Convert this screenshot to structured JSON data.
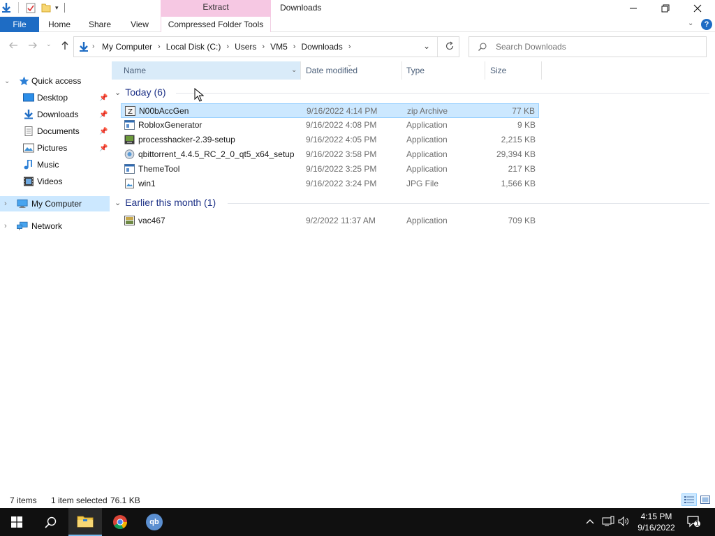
{
  "titlebar": {
    "context_tab": "Extract",
    "window_title": "Downloads"
  },
  "ribbon": {
    "file": "File",
    "home": "Home",
    "share": "Share",
    "view": "View",
    "compressed": "Compressed Folder Tools"
  },
  "address": {
    "crumbs": [
      "My Computer",
      "Local Disk (C:)",
      "Users",
      "VM5",
      "Downloads"
    ],
    "search_placeholder": "Search Downloads"
  },
  "navpane": {
    "quick_access": "Quick access",
    "items": [
      {
        "label": "Desktop",
        "icon": "desktop-icon",
        "pinned": true
      },
      {
        "label": "Downloads",
        "icon": "downloads-icon",
        "pinned": true
      },
      {
        "label": "Documents",
        "icon": "documents-icon",
        "pinned": true
      },
      {
        "label": "Pictures",
        "icon": "pictures-icon",
        "pinned": true
      },
      {
        "label": "Music",
        "icon": "music-icon",
        "pinned": false
      },
      {
        "label": "Videos",
        "icon": "videos-icon",
        "pinned": false
      }
    ],
    "my_computer": "My Computer",
    "network": "Network"
  },
  "columns": {
    "name": "Name",
    "date": "Date modified",
    "type": "Type",
    "size": "Size"
  },
  "groups": [
    {
      "title": "Today (6)",
      "files": [
        {
          "name": "N00bAccGen",
          "date": "9/16/2022 4:14 PM",
          "type": "zip Archive",
          "size": "77 KB",
          "icon": "zip-icon",
          "selected": true
        },
        {
          "name": "RobloxGenerator",
          "date": "9/16/2022 4:08 PM",
          "type": "Application",
          "size": "9 KB",
          "icon": "app-icon"
        },
        {
          "name": "processhacker-2.39-setup",
          "date": "9/16/2022 4:05 PM",
          "type": "Application",
          "size": "2,215 KB",
          "icon": "installer-icon"
        },
        {
          "name": "qbittorrent_4.4.5_RC_2_0_qt5_x64_setup",
          "date": "9/16/2022 3:58 PM",
          "type": "Application",
          "size": "29,394 KB",
          "icon": "qbittorrent-setup-icon"
        },
        {
          "name": "ThemeTool",
          "date": "9/16/2022 3:25 PM",
          "type": "Application",
          "size": "217 KB",
          "icon": "app-icon"
        },
        {
          "name": "win1",
          "date": "9/16/2022 3:24 PM",
          "type": "JPG File",
          "size": "1,566 KB",
          "icon": "image-file-icon"
        }
      ]
    },
    {
      "title": "Earlier this month (1)",
      "files": [
        {
          "name": "vac467",
          "date": "9/2/2022 11:37 AM",
          "type": "Application",
          "size": "709 KB",
          "icon": "setup-app-icon"
        }
      ]
    }
  ],
  "status": {
    "items": "7 items",
    "selected": "1 item selected",
    "size": "76.1 KB"
  },
  "taskbar": {
    "time": "4:15 PM",
    "date": "9/16/2022",
    "notification_count": "1"
  },
  "colors": {
    "accent": "#1e6cc4",
    "selection": "#cce8ff",
    "selection_border": "#99d1ff",
    "context_tab": "#f6c8e3",
    "group_title": "#1e3287",
    "taskbar": "#101010"
  }
}
